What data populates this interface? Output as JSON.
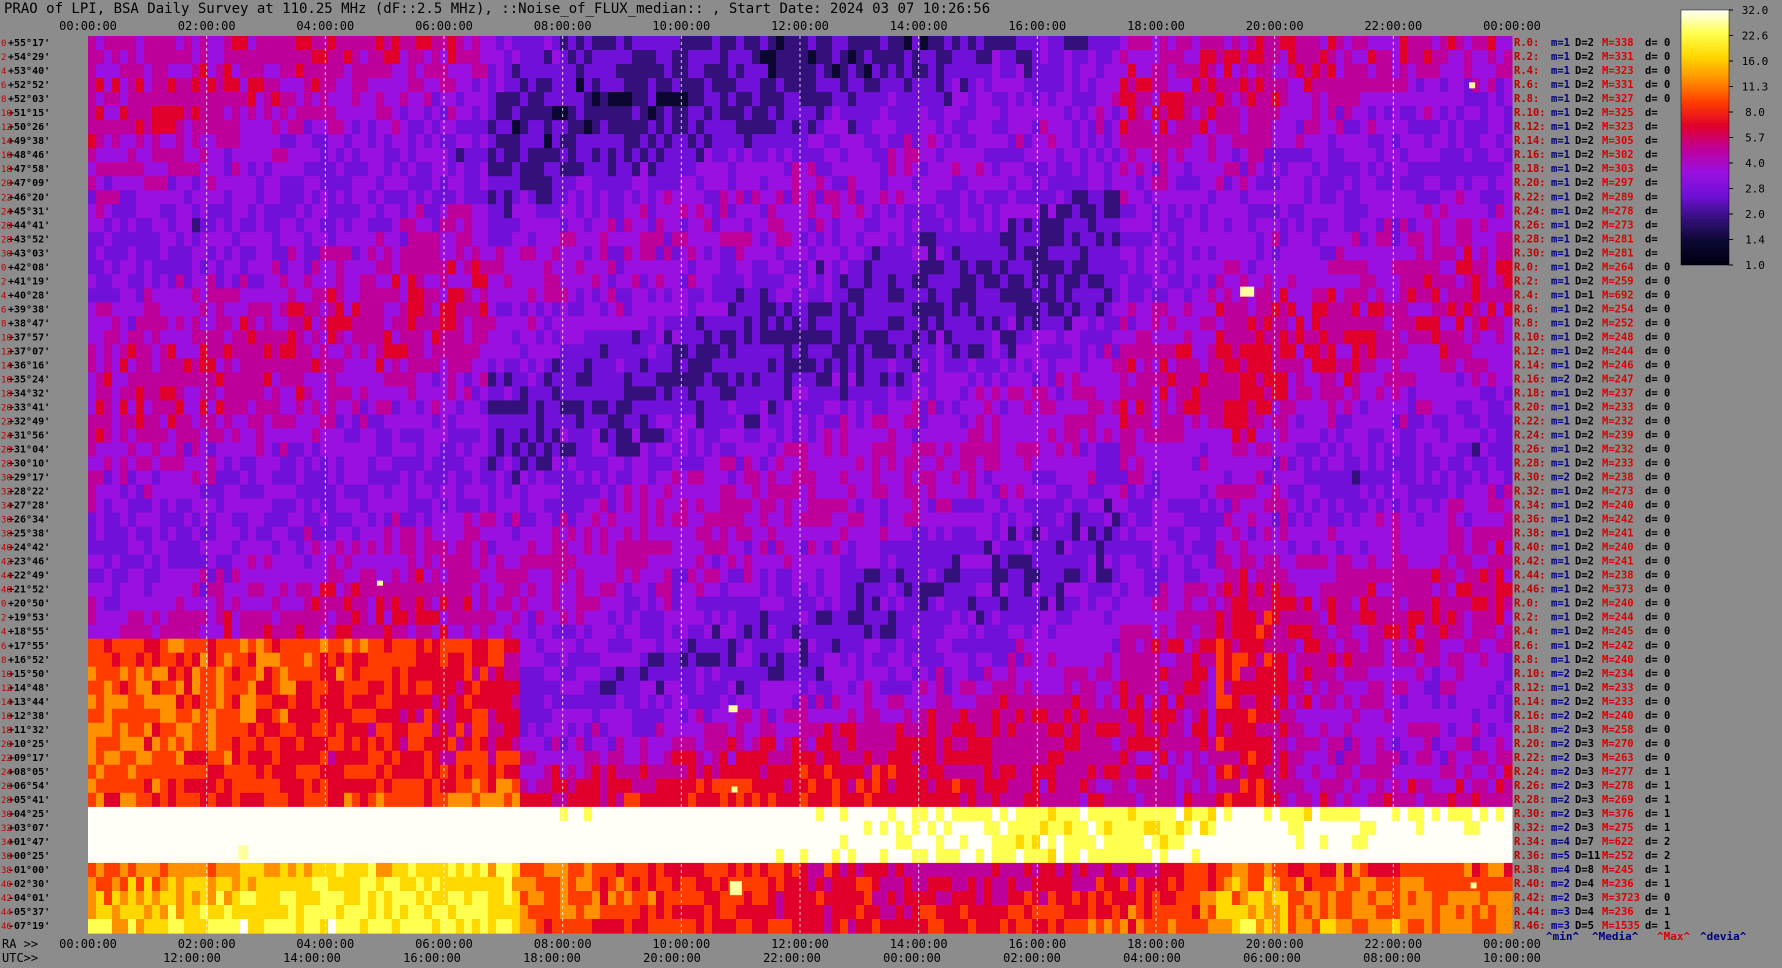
{
  "chart_data": {
    "type": "heatmap",
    "title": "PRAO of LPI, BSA Daily Survey at 110.25 MHz (dF::2.5 MHz), ::Noise_of_FLUX_median:: , Start Date: 2024 03 07 10:26:56",
    "x_top_ticks": [
      "00:00:00",
      "02:00:00",
      "04:00:00",
      "06:00:00",
      "08:00:00",
      "10:00:00",
      "12:00:00",
      "14:00:00",
      "16:00:00",
      "18:00:00",
      "20:00:00",
      "22:00:00",
      "00:00:00"
    ],
    "x_bottom_ra_label": "RA >>",
    "x_bottom_ra_ticks": [
      "00:00:00",
      "02:00:00",
      "04:00:00",
      "06:00:00",
      "08:00:00",
      "10:00:00",
      "12:00:00",
      "14:00:00",
      "16:00:00",
      "18:00:00",
      "20:00:00",
      "22:00:00",
      "00:00:00"
    ],
    "x_bottom_utc_label": "UTC>>",
    "x_bottom_utc_ticks": [
      "12:00:00",
      "14:00:00",
      "16:00:00",
      "18:00:00",
      "20:00:00",
      "22:00:00",
      "00:00:00",
      "02:00:00",
      "04:00:00",
      "06:00:00",
      "08:00:00",
      "10:00:00"
    ],
    "y_declinations": [
      "+55°17'",
      "+54°29'",
      "+53°40'",
      "+52°52'",
      "+52°03'",
      "+51°15'",
      "+50°26'",
      "+49°38'",
      "+48°46'",
      "+47°58'",
      "+47°09'",
      "+46°20'",
      "+45°31'",
      "+44°41'",
      "+43°52'",
      "+43°03'",
      "+42°08'",
      "+41°19'",
      "+40°28'",
      "+39°38'",
      "+38°47'",
      "+37°57'",
      "+37°07'",
      "+36°16'",
      "+35°24'",
      "+34°32'",
      "+33°41'",
      "+32°49'",
      "+31°56'",
      "+31°04'",
      "+30°10'",
      "+29°17'",
      "+28°22'",
      "+27°28'",
      "+26°34'",
      "+25°38'",
      "+24°42'",
      "+23°46'",
      "+22°49'",
      "+21°52'",
      "+20°50'",
      "+19°53'",
      "+18°55'",
      "+17°55'",
      "+16°52'",
      "+15°50'",
      "+14°48'",
      "+13°44'",
      "+12°38'",
      "+11°32'",
      "+10°25'",
      "+09°17'",
      "+08°05'",
      "+06°54'",
      "+05°41'",
      "+04°25'",
      "+03°07'",
      "+01°47'",
      "+00°25'",
      "-01°00'",
      "-02°30'",
      "-04°01'",
      "-05°37'",
      "-07°19'"
    ],
    "y_index_labels": [
      "0",
      "2",
      "4",
      "6",
      "8",
      "10",
      "12",
      "14",
      "16",
      "18",
      "20",
      "22",
      "24",
      "26",
      "28",
      "30",
      "0",
      "2",
      "4",
      "6",
      "8",
      "10",
      "12",
      "14",
      "16",
      "18",
      "20",
      "22",
      "24",
      "26",
      "28",
      "30",
      "32",
      "34",
      "36",
      "38",
      "40",
      "42",
      "44",
      "46",
      "0",
      "2",
      "4",
      "6",
      "8",
      "10",
      "12",
      "14",
      "16",
      "18",
      "20",
      "22",
      "24",
      "26",
      "28",
      "30",
      "32",
      "34",
      "36",
      "38",
      "40",
      "42",
      "44",
      "46"
    ],
    "colorbar": {
      "ticks": [
        "32.0",
        "22.6",
        "16.0",
        "11.3",
        "8.0",
        "5.7",
        "4.0",
        "2.8",
        "2.0",
        "1.4",
        "1.0"
      ],
      "scale": "log",
      "range": [
        1.0,
        32.0
      ],
      "colors": [
        "#fffff8",
        "#ffff50",
        "#ffd800",
        "#ff9000",
        "#ff3c00",
        "#e0002a",
        "#c0009a",
        "#9a10e0",
        "#7010d8",
        "#34107a",
        "#0a0830",
        "#000010"
      ]
    },
    "stats_rows": [
      {
        "r": "R.0:",
        "m": "m=1",
        "d": "D=2",
        "x": "M=338",
        "v": "d= 0"
      },
      {
        "r": "R.2:",
        "m": "m=1",
        "d": "D=2",
        "x": "M=331",
        "v": "d= 0"
      },
      {
        "r": "R.4:",
        "m": "m=1",
        "d": "D=2",
        "x": "M=323",
        "v": "d= 0"
      },
      {
        "r": "R.6:",
        "m": "m=1",
        "d": "D=2",
        "x": "M=331",
        "v": "d= 0"
      },
      {
        "r": "R.8:",
        "m": "m=1",
        "d": "D=2",
        "x": "M=327",
        "v": "d= 0"
      },
      {
        "r": "R.10:",
        "m": "m=1",
        "d": "D=2",
        "x": "M=325",
        "v": "d="
      },
      {
        "r": "R.12:",
        "m": "m=1",
        "d": "D=2",
        "x": "M=323",
        "v": "d="
      },
      {
        "r": "R.14:",
        "m": "m=1",
        "d": "D=2",
        "x": "M=305",
        "v": "d="
      },
      {
        "r": "R.16:",
        "m": "m=1",
        "d": "D=2",
        "x": "M=302",
        "v": "d="
      },
      {
        "r": "R.18:",
        "m": "m=1",
        "d": "D=2",
        "x": "M=303",
        "v": "d="
      },
      {
        "r": "R.20:",
        "m": "m=1",
        "d": "D=2",
        "x": "M=297",
        "v": "d="
      },
      {
        "r": "R.22:",
        "m": "m=1",
        "d": "D=2",
        "x": "M=289",
        "v": "d="
      },
      {
        "r": "R.24:",
        "m": "m=1",
        "d": "D=2",
        "x": "M=278",
        "v": "d="
      },
      {
        "r": "R.26:",
        "m": "m=1",
        "d": "D=2",
        "x": "M=273",
        "v": "d="
      },
      {
        "r": "R.28:",
        "m": "m=1",
        "d": "D=2",
        "x": "M=281",
        "v": "d="
      },
      {
        "r": "R.30:",
        "m": "m=1",
        "d": "D=2",
        "x": "M=281",
        "v": "d="
      },
      {
        "r": "R.0:",
        "m": "m=1",
        "d": "D=2",
        "x": "M=264",
        "v": "d= 0"
      },
      {
        "r": "R.2:",
        "m": "m=1",
        "d": "D=2",
        "x": "M=259",
        "v": "d= 0"
      },
      {
        "r": "R.4:",
        "m": "m=1",
        "d": "D=1",
        "x": "M=692",
        "v": "d= 0"
      },
      {
        "r": "R.6:",
        "m": "m=1",
        "d": "D=2",
        "x": "M=254",
        "v": "d= 0"
      },
      {
        "r": "R.8:",
        "m": "m=1",
        "d": "D=2",
        "x": "M=252",
        "v": "d= 0"
      },
      {
        "r": "R.10:",
        "m": "m=1",
        "d": "D=2",
        "x": "M=248",
        "v": "d= 0"
      },
      {
        "r": "R.12:",
        "m": "m=1",
        "d": "D=2",
        "x": "M=244",
        "v": "d= 0"
      },
      {
        "r": "R.14:",
        "m": "m=1",
        "d": "D=2",
        "x": "M=246",
        "v": "d= 0"
      },
      {
        "r": "R.16:",
        "m": "m=2",
        "d": "D=2",
        "x": "M=247",
        "v": "d= 0"
      },
      {
        "r": "R.18:",
        "m": "m=1",
        "d": "D=2",
        "x": "M=237",
        "v": "d= 0"
      },
      {
        "r": "R.20:",
        "m": "m=1",
        "d": "D=2",
        "x": "M=233",
        "v": "d= 0"
      },
      {
        "r": "R.22:",
        "m": "m=1",
        "d": "D=2",
        "x": "M=232",
        "v": "d= 0"
      },
      {
        "r": "R.24:",
        "m": "m=1",
        "d": "D=2",
        "x": "M=239",
        "v": "d= 0"
      },
      {
        "r": "R.26:",
        "m": "m=1",
        "d": "D=2",
        "x": "M=232",
        "v": "d= 0"
      },
      {
        "r": "R.28:",
        "m": "m=1",
        "d": "D=2",
        "x": "M=233",
        "v": "d= 0"
      },
      {
        "r": "R.30:",
        "m": "m=2",
        "d": "D=2",
        "x": "M=238",
        "v": "d= 0"
      },
      {
        "r": "R.32:",
        "m": "m=1",
        "d": "D=2",
        "x": "M=273",
        "v": "d= 0"
      },
      {
        "r": "R.34:",
        "m": "m=1",
        "d": "D=2",
        "x": "M=240",
        "v": "d= 0"
      },
      {
        "r": "R.36:",
        "m": "m=1",
        "d": "D=2",
        "x": "M=242",
        "v": "d= 0"
      },
      {
        "r": "R.38:",
        "m": "m=1",
        "d": "D=2",
        "x": "M=241",
        "v": "d= 0"
      },
      {
        "r": "R.40:",
        "m": "m=1",
        "d": "D=2",
        "x": "M=240",
        "v": "d= 0"
      },
      {
        "r": "R.42:",
        "m": "m=1",
        "d": "D=2",
        "x": "M=241",
        "v": "d= 0"
      },
      {
        "r": "R.44:",
        "m": "m=1",
        "d": "D=2",
        "x": "M=238",
        "v": "d= 0"
      },
      {
        "r": "R.46:",
        "m": "m=1",
        "d": "D=2",
        "x": "M=373",
        "v": "d= 0"
      },
      {
        "r": "R.0:",
        "m": "m=1",
        "d": "D=2",
        "x": "M=240",
        "v": "d= 0"
      },
      {
        "r": "R.2:",
        "m": "m=1",
        "d": "D=2",
        "x": "M=244",
        "v": "d= 0"
      },
      {
        "r": "R.4:",
        "m": "m=1",
        "d": "D=2",
        "x": "M=245",
        "v": "d= 0"
      },
      {
        "r": "R.6:",
        "m": "m=1",
        "d": "D=2",
        "x": "M=242",
        "v": "d= 0"
      },
      {
        "r": "R.8:",
        "m": "m=1",
        "d": "D=2",
        "x": "M=240",
        "v": "d= 0"
      },
      {
        "r": "R.10:",
        "m": "m=2",
        "d": "D=2",
        "x": "M=234",
        "v": "d= 0"
      },
      {
        "r": "R.12:",
        "m": "m=1",
        "d": "D=2",
        "x": "M=233",
        "v": "d= 0"
      },
      {
        "r": "R.14:",
        "m": "m=2",
        "d": "D=2",
        "x": "M=233",
        "v": "d= 0"
      },
      {
        "r": "R.16:",
        "m": "m=2",
        "d": "D=2",
        "x": "M=240",
        "v": "d= 0"
      },
      {
        "r": "R.18:",
        "m": "m=2",
        "d": "D=3",
        "x": "M=258",
        "v": "d= 0"
      },
      {
        "r": "R.20:",
        "m": "m=2",
        "d": "D=3",
        "x": "M=270",
        "v": "d= 0"
      },
      {
        "r": "R.22:",
        "m": "m=2",
        "d": "D=3",
        "x": "M=263",
        "v": "d= 0"
      },
      {
        "r": "R.24:",
        "m": "m=2",
        "d": "D=3",
        "x": "M=277",
        "v": "d= 1"
      },
      {
        "r": "R.26:",
        "m": "m=2",
        "d": "D=3",
        "x": "M=278",
        "v": "d= 1"
      },
      {
        "r": "R.28:",
        "m": "m=2",
        "d": "D=3",
        "x": "M=269",
        "v": "d= 1"
      },
      {
        "r": "R.30:",
        "m": "m=2",
        "d": "D=3",
        "x": "M=376",
        "v": "d= 1"
      },
      {
        "r": "R.32:",
        "m": "m=2",
        "d": "D=3",
        "x": "M=275",
        "v": "d= 1"
      },
      {
        "r": "R.34:",
        "m": "m=4",
        "d": "D=7",
        "x": "M=622",
        "v": "d= 2"
      },
      {
        "r": "R.36:",
        "m": "m=5",
        "d": "D=11",
        "x": "M=252",
        "v": "d= 2"
      },
      {
        "r": "R.38:",
        "m": "m=4",
        "d": "D=8",
        "x": "M=245",
        "v": "d= 1"
      },
      {
        "r": "R.40:",
        "m": "m=2",
        "d": "D=4",
        "x": "M=236",
        "v": "d= 1"
      },
      {
        "r": "R.42:",
        "m": "m=2",
        "d": "D=3",
        "x": "M=3723",
        "v": "d= 0"
      },
      {
        "r": "R.44:",
        "m": "m=3",
        "d": "D=4",
        "x": "M=236",
        "v": "d= 1"
      },
      {
        "r": "R.46:",
        "m": "m=3",
        "d": "D=5",
        "x": "M=1535",
        "v": "d= 1"
      }
    ],
    "stats_legend": {
      "min": "^min^",
      "median": "^Media^",
      "max": "^Max^",
      "devia": "^devia^"
    }
  }
}
